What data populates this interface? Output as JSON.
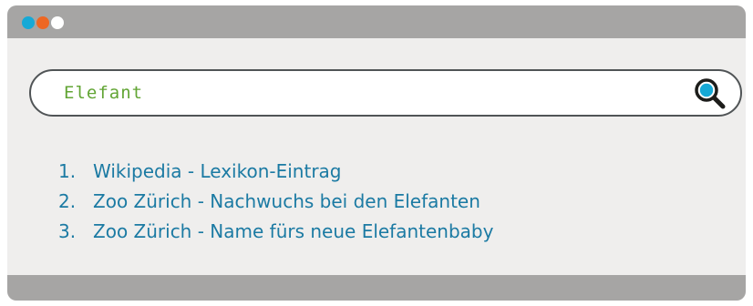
{
  "window": {
    "controls": [
      {
        "name": "close",
        "color": "#16a9d6"
      },
      {
        "name": "minimize",
        "color": "#ee6723"
      },
      {
        "name": "maximize",
        "color": "#ffffff"
      }
    ]
  },
  "search": {
    "query": "Elefant",
    "icon": "search-icon",
    "accent": "#16a9d6"
  },
  "results": [
    {
      "number": "1.",
      "text": "Wikipedia - Lexikon-Eintrag"
    },
    {
      "number": "2.",
      "text": "Zoo Zürich - Nachwuchs bei den Elefanten"
    },
    {
      "number": "3.",
      "text": "Zoo Zürich - Name fürs neue Elefantenbaby"
    }
  ],
  "colors": {
    "link": "#1b7aa3",
    "query_text": "#62a534",
    "chrome": "#a6a5a4",
    "background": "#efeeed"
  }
}
